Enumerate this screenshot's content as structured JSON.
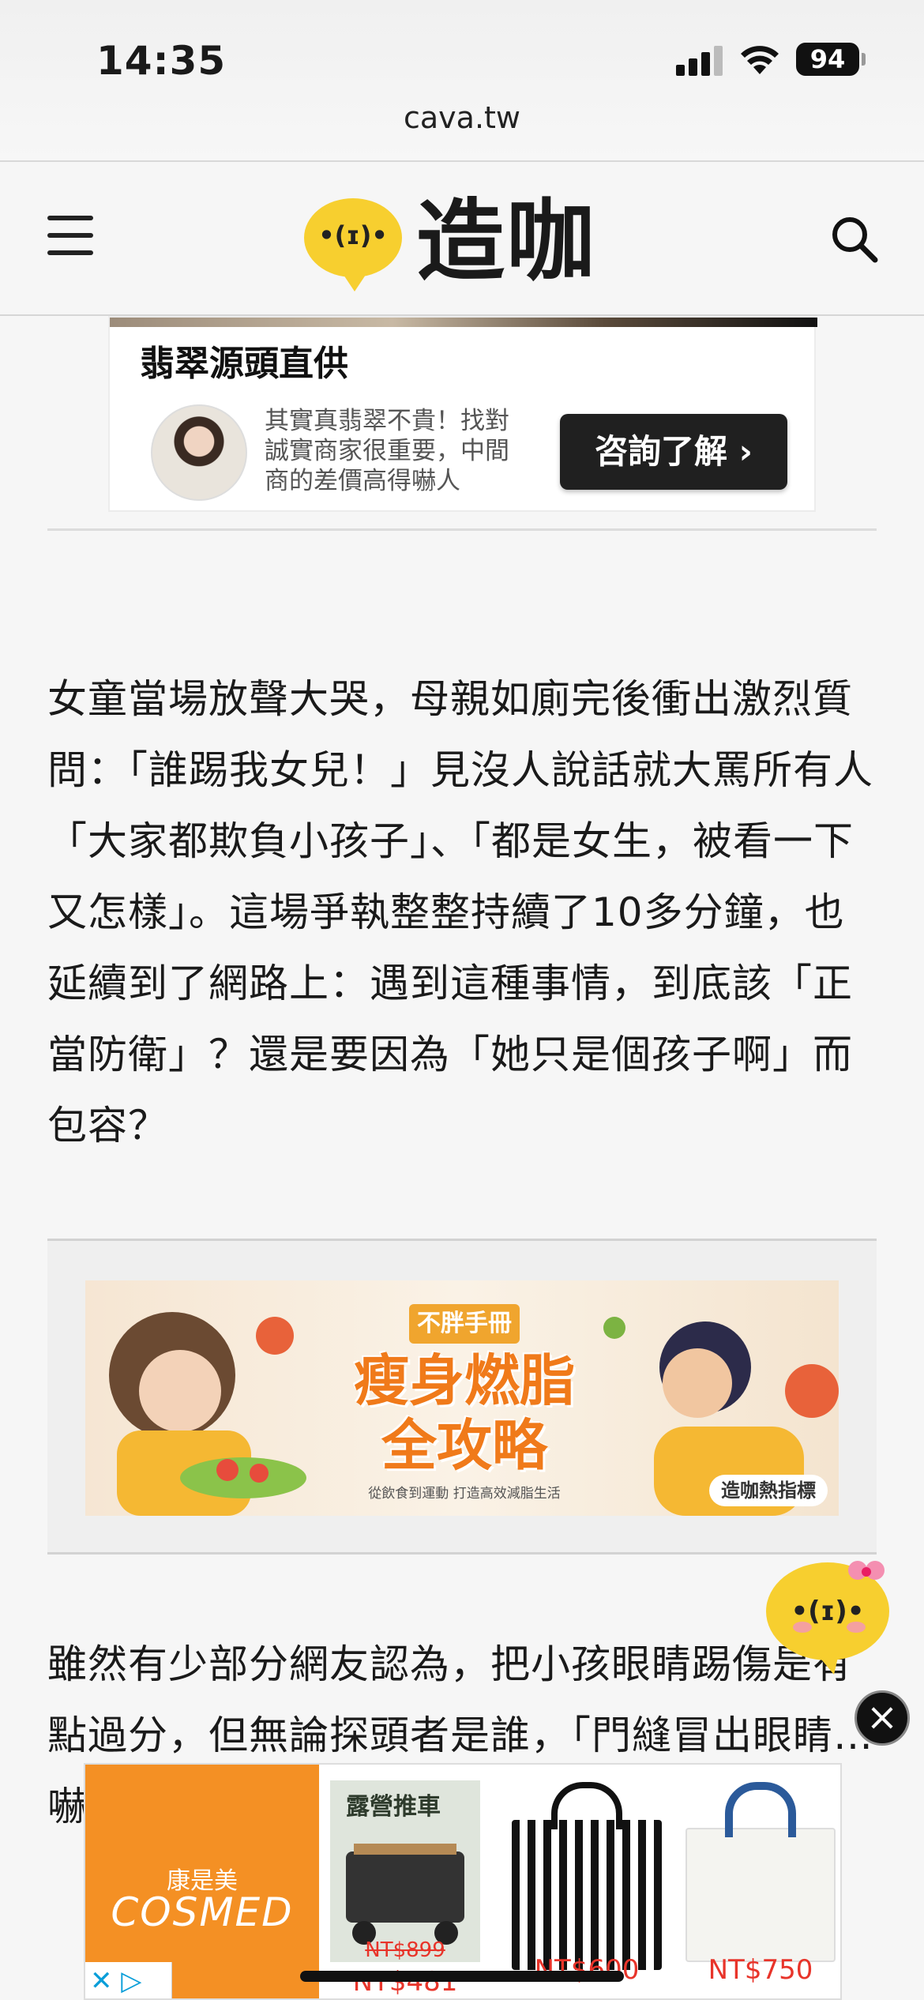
{
  "status": {
    "time": "14:35",
    "battery": "94",
    "url": "cava.tw"
  },
  "header": {
    "logo_face": "•(ɪ)•",
    "logo_text": "造咖"
  },
  "top_ad": {
    "title": "翡翠源頭直供",
    "description": "其實真翡翠不貴！找對誠實商家很重要，中間商的差價高得嚇人",
    "cta": "咨詢了解 ›"
  },
  "article": {
    "paragraph_1": "女童當場放聲大哭，母親如廁完後衝出激烈質問：「誰踢我女兒！」見沒人說話就大罵所有人「大家都欺負小孩子」、「都是女生，被看一下又怎樣」。這場爭執整整持續了10多分鐘，也延續到了網路上：遇到這種事情，到底該「正當防衛」？還是要因為「她只是個孩子啊」而包容？",
    "paragraph_2": "雖然有少部分網友認為，把小孩眼睛踢傷是有點過分，但無論探頭者是誰，「門縫冒出眼睛…嚇當…非…"
  },
  "mid_ad": {
    "tag": "不胖手冊",
    "headline_1": "瘦身燃脂",
    "headline_2": "全攻略",
    "sub": "從飲食到運動 打造高效減脂生活",
    "badge": "造咖熱指標"
  },
  "mascot": {
    "face": "•(ɪ)•",
    "close": "×"
  },
  "bottom_ad": {
    "brand_cn": "康是美",
    "brand_en": "COSMED",
    "products": [
      {
        "label": "露營推車",
        "old_price": "NT$899",
        "price": "NT$481"
      },
      {
        "label": "",
        "price": "NT$600"
      },
      {
        "label": "",
        "price": "NT$750"
      }
    ],
    "ad_marker": "✕ ▷"
  },
  "colors": {
    "brand_yellow": "#f7cf2f",
    "ad_orange": "#f49024",
    "price_red": "#e8342a"
  }
}
